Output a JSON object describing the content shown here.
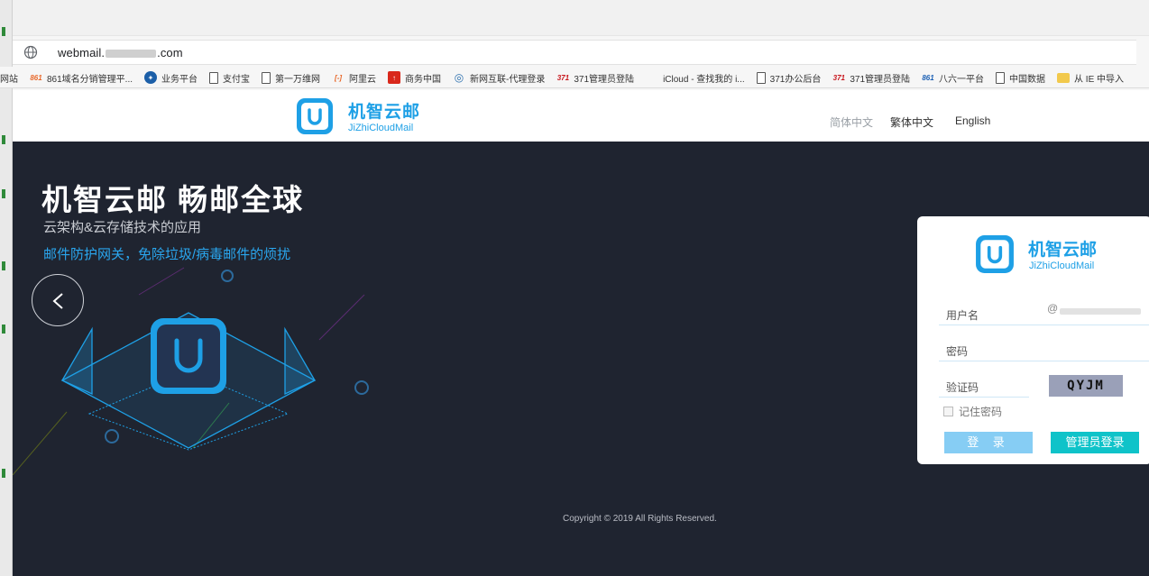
{
  "browser": {
    "url_prefix": "webmail.",
    "url_suffix": ".com",
    "bookmarks": [
      {
        "icon": "none",
        "icon_text": "",
        "label": "网站"
      },
      {
        "icon": "orange",
        "icon_text": "861",
        "label": "861域名分销管理平..."
      },
      {
        "icon": "circle",
        "icon_text": "✦",
        "label": "业务平台"
      },
      {
        "icon": "doc",
        "icon_text": "",
        "label": "支付宝"
      },
      {
        "icon": "doc",
        "icon_text": "",
        "label": "第一万维网"
      },
      {
        "icon": "orange",
        "icon_text": "[-]",
        "label": "阿里云"
      },
      {
        "icon": "flag",
        "icon_text": "↑",
        "label": "商务中国"
      },
      {
        "icon": "green",
        "icon_text": "◎",
        "label": "新网互联-代理登录"
      },
      {
        "icon": "red",
        "icon_text": "371",
        "label": "371管理员登陆"
      },
      {
        "icon": "apple",
        "icon_text": "",
        "label": "iCloud - 查找我的 i..."
      },
      {
        "icon": "doc",
        "icon_text": "",
        "label": "371办公后台"
      },
      {
        "icon": "red",
        "icon_text": "371",
        "label": "371管理员登陆"
      },
      {
        "icon": "blue",
        "icon_text": "861",
        "label": "八六一平台"
      },
      {
        "icon": "doc",
        "icon_text": "",
        "label": "中国数据"
      },
      {
        "icon": "folder",
        "icon_text": "",
        "label": "从 IE 中导入"
      }
    ]
  },
  "header": {
    "brand_cn": "机智云邮",
    "brand_en": "JiZhiCloudMail",
    "languages": [
      "简体中文",
      "繁体中文",
      "English"
    ]
  },
  "banner": {
    "headline": "机智云邮 畅邮全球",
    "subline": "云架构&云存储技术的应用",
    "tagline": "邮件防护网关，免除垃圾/病毒邮件的烦扰"
  },
  "login": {
    "brand_cn": "机智云邮",
    "brand_en": "JiZhiCloudMail",
    "username_label": "用户名",
    "username_at": "@",
    "password_label": "密码",
    "captcha_label": "验证码",
    "captcha_text": "QYJM",
    "remember_label": "记住密码",
    "login_button": "登 录",
    "admin_button": "管理员登录"
  },
  "footer": {
    "copyright": "Copyright © 2019 All Rights Reserved."
  },
  "colors": {
    "brand": "#1ea0e6",
    "banner_bg": "#1f2430",
    "login_btn": "#86cdf4",
    "admin_btn": "#0fc3c9"
  }
}
